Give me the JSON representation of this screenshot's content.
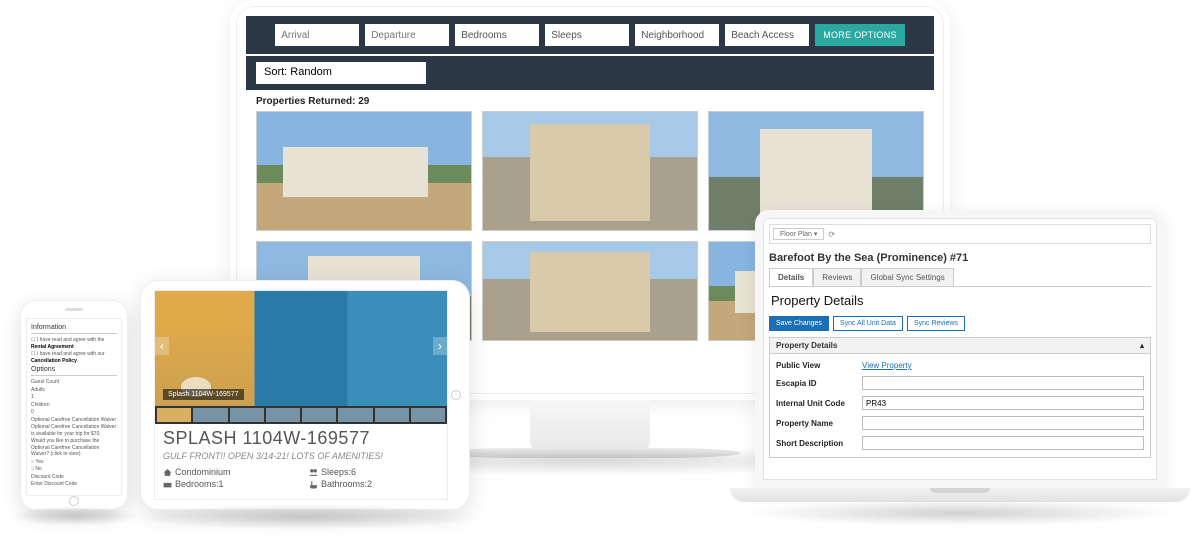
{
  "monitor": {
    "filters": {
      "arrival_ph": "Arrival",
      "departure_ph": "Departure",
      "bedrooms": "Bedrooms",
      "sleeps": "Sleeps",
      "neighborhood": "Neighborhood",
      "beach_access": "Beach Access",
      "more_options": "MORE OPTIONS"
    },
    "sort_label": "Sort: Random",
    "results_label": "Properties Returned: 29"
  },
  "tablet": {
    "hero_label": "Splash 1104W-169577",
    "title": "SPLASH 1104W-169577",
    "subtitle": "GULF FRONT!! OPEN 3/14-21! LOTS OF AMENITIES!",
    "type": "Condominium",
    "sleeps": "Sleeps:6",
    "bedrooms": "Bedrooms:1",
    "bathrooms": "Bathrooms:2"
  },
  "phone": {
    "section1": "Information",
    "line1a": "I have read and agree with the",
    "line1b": "Rental Agreement",
    "line2a": "I have read and agree with our",
    "line2b": "Cancellation Policy",
    "section2": "Options",
    "guest_count": "Guest Count",
    "adults": "Adults",
    "adults_val": "1",
    "children": "Children",
    "children_val": "0",
    "waiver_h": "Optional Carefree Cancellation Waiver",
    "waiver_body": "Optional Carefree Cancellation Waiver is available for your trip for $70.",
    "waiver_q": "Would you like to purchase the Optional Carefree Cancellation Waiver? (click to view)",
    "opt_yes": "Yes",
    "opt_no": "No",
    "discount_h": "Discount Code",
    "discount_ph": "Enter Discount Code"
  },
  "laptop": {
    "tab": "Floor Plan",
    "title": "Barefoot By the Sea (Prominence) #71",
    "tabs": [
      "Details",
      "Reviews",
      "Global Sync Settings"
    ],
    "section": "Property Details",
    "btn_save": "Save Changes",
    "btn_sync_unit": "Sync All Unit Data",
    "btn_sync_reviews": "Sync Reviews",
    "panel_h": "Property Details",
    "fields": {
      "public_view": "Public View",
      "public_view_link": "View Property",
      "escapia_id": "Escapia ID",
      "internal_code": "Internal Unit Code",
      "internal_code_val": "PR43",
      "property_name": "Property Name",
      "short_desc": "Short Description"
    }
  }
}
